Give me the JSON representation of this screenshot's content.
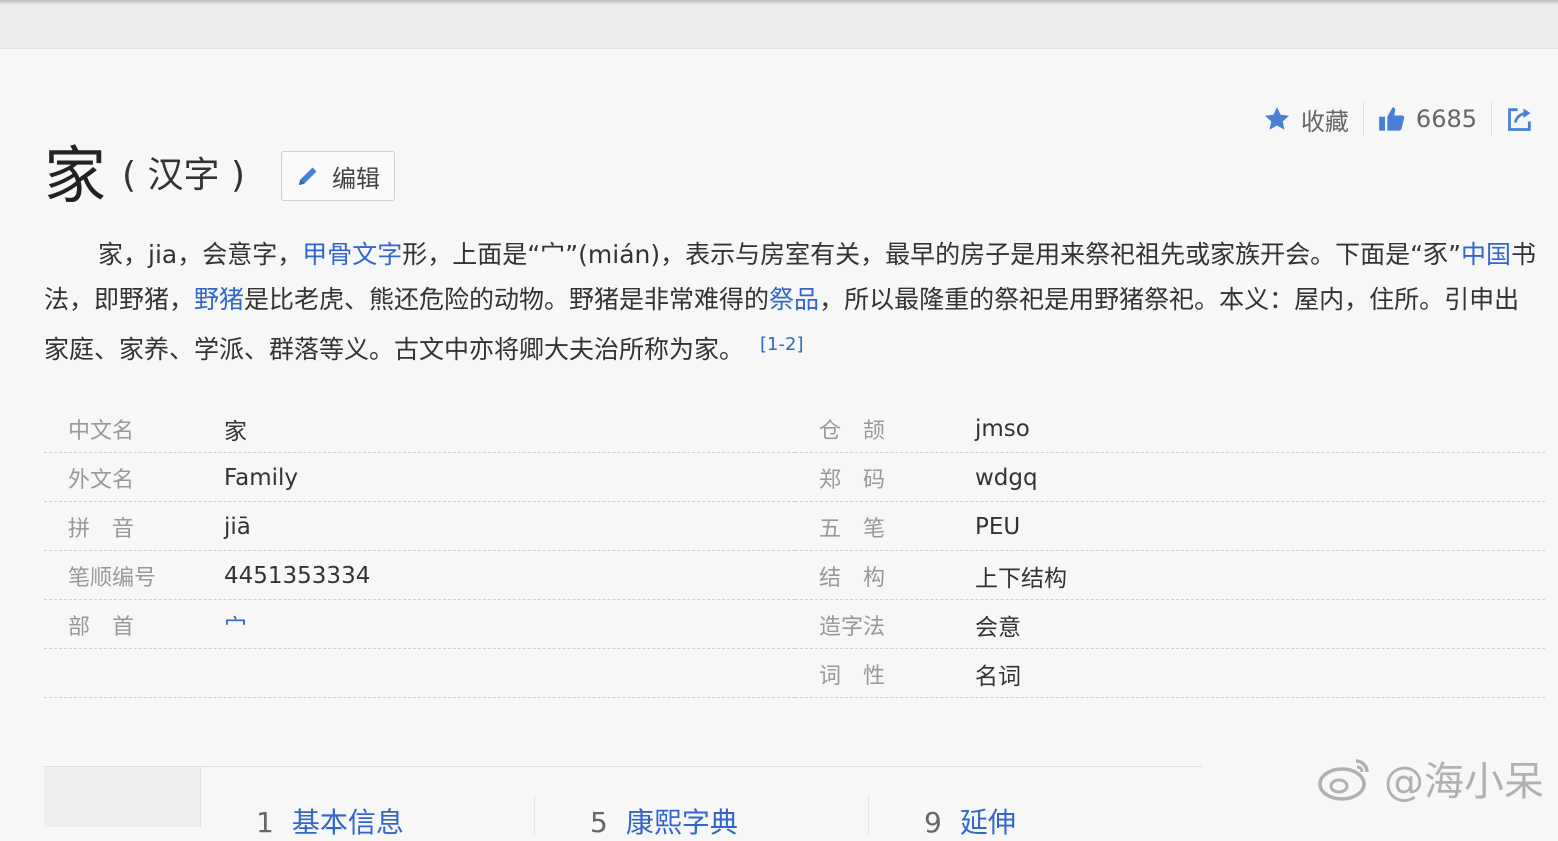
{
  "colors": {
    "accent": "#3366cc",
    "icon": "#4a7fd6",
    "label": "#999999",
    "text": "#333333"
  },
  "actions": {
    "favorite": {
      "icon": "star-icon",
      "label": "收藏"
    },
    "like": {
      "icon": "thumbs-up-icon",
      "count": "6685"
    },
    "share": {
      "icon": "share-icon"
    }
  },
  "title": {
    "main": "家",
    "sub": "( 汉字 )"
  },
  "edit": {
    "icon": "pencil-icon",
    "label": "编辑"
  },
  "summary": {
    "t1": "家，jia，会意字，",
    "l1": "甲骨文字",
    "t2": "形，上面是“宀”(mián)，表示与房室有关，最早的房子是用来祭祀祖先或家族开会。下面是“豕”",
    "l2": "中国",
    "t3": "书法，即野猪，",
    "l3": "野猪",
    "t4": "是比老虎、熊还危险的动物。野猪是非常难得的",
    "l4": "祭品",
    "t5": "，所以最隆重的祭祀是用野猪祭祀。本义：屋内，住所。引申出家庭、家养、学派、群落等义。古文中亦将卿大夫治所称为家。",
    "ref": "[1-2]"
  },
  "info_left": [
    {
      "label": "中文名",
      "value": "家"
    },
    {
      "label": "外文名",
      "value": "Family"
    },
    {
      "label": "拼　音",
      "value": "jiā"
    },
    {
      "label": "笔顺编号",
      "value": "4451353334"
    },
    {
      "label": "部　首",
      "value": "宀"
    }
  ],
  "info_right": [
    {
      "label": "仓　颉",
      "value": "jmso"
    },
    {
      "label": "郑　码",
      "value": "wdgq"
    },
    {
      "label": "五　笔",
      "value": "PEU"
    },
    {
      "label": "结　构",
      "value": "上下结构"
    },
    {
      "label": "造字法",
      "value": "会意"
    },
    {
      "label": "词　性",
      "value": "名词"
    }
  ],
  "toc": [
    {
      "num": "1",
      "label": "基本信息"
    },
    {
      "num": "5",
      "label": "康熙字典"
    },
    {
      "num": "9",
      "label": "延伸"
    }
  ],
  "watermark": {
    "icon": "weibo-icon",
    "text": "@海小呆"
  }
}
